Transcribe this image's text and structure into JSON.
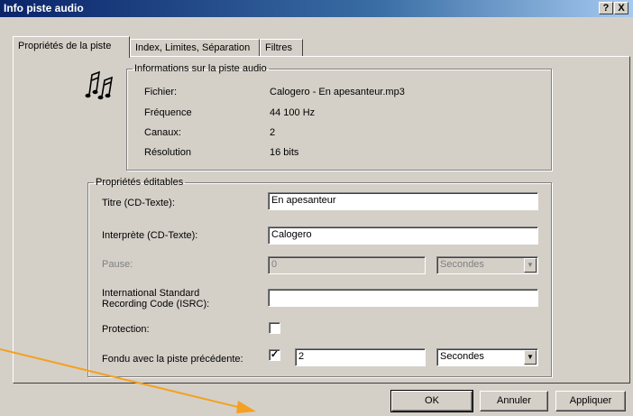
{
  "window": {
    "title": "Info piste audio",
    "help_button": "?",
    "close_button": "X"
  },
  "tabs": [
    {
      "label": "Propriétés de la piste",
      "active": true
    },
    {
      "label": "Index, Limites, Séparation",
      "active": false
    },
    {
      "label": "Filtres",
      "active": false
    }
  ],
  "info": {
    "legend": "Informations sur la piste audio",
    "icon": "music-notes-icon",
    "rows": [
      {
        "label": "Fichier:",
        "value": "Calogero - En apesanteur.mp3"
      },
      {
        "label": "Fréquence",
        "value": "44 100 Hz"
      },
      {
        "label": "Canaux:",
        "value": "2"
      },
      {
        "label": "Résolution",
        "value": "16 bits"
      }
    ]
  },
  "editable": {
    "legend": "Propriétés éditables",
    "title_label": "Titre (CD-Texte):",
    "title_value": "En apesanteur",
    "performer_label": "Interprète (CD-Texte):",
    "performer_value": "Calogero",
    "pause_label": "Pause:",
    "pause_value": "0",
    "pause_unit": "Secondes",
    "isrc_label_line1": "International Standard",
    "isrc_label_line2": "Recording Code (ISRC):",
    "isrc_value": "",
    "protection_label": "Protection:",
    "protection_checked": false,
    "fade_label": "Fondu avec la piste précédente:",
    "fade_checked": true,
    "fade_value": "2",
    "fade_unit": "Secondes"
  },
  "buttons": {
    "ok": "OK",
    "cancel": "Annuler",
    "apply": "Appliquer"
  },
  "colors": {
    "annotation_arrow": "#f5a020",
    "titlebar": "#0a246a"
  }
}
